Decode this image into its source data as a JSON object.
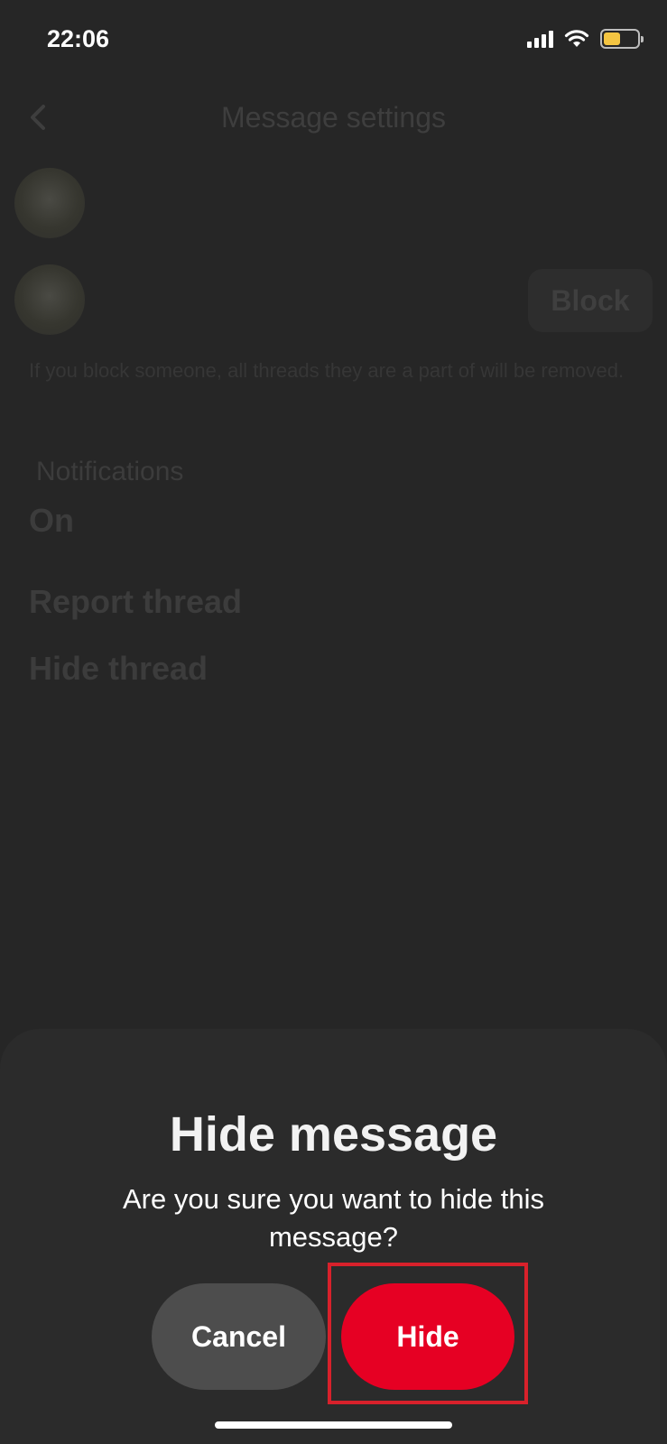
{
  "status_bar": {
    "time": "22:06",
    "signal_icon": "cellular-signal-icon",
    "wifi_icon": "wifi-icon",
    "battery_icon": "battery-icon",
    "battery_level": 0.5,
    "battery_color": "#f4c542"
  },
  "background_page": {
    "back_icon": "chevron-left-icon",
    "title": "Message settings",
    "block_label": "Block",
    "block_note": "If you block someone, all threads they are a part of will be removed.",
    "notifications_label": "Notifications",
    "notifications_value": "On",
    "report_thread": "Report thread",
    "hide_thread": "Hide thread"
  },
  "dialog": {
    "title": "Hide message",
    "body": "Are you sure you want to hide this message?",
    "cancel_label": "Cancel",
    "confirm_label": "Hide",
    "confirm_color": "#e60023",
    "highlight_color": "#d8212b"
  }
}
